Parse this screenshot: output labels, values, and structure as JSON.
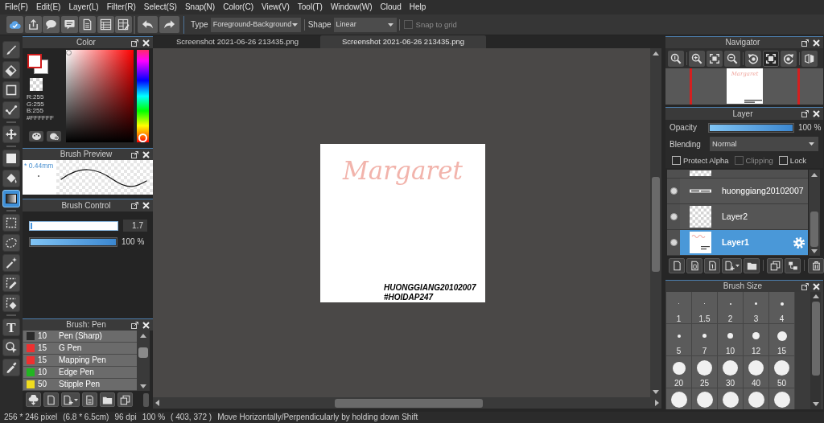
{
  "menu_bar": [
    "File(F)",
    "Edit(E)",
    "Layer(L)",
    "Filter(R)",
    "Select(S)",
    "Snap(N)",
    "Color(C)",
    "View(V)",
    "Tool(T)",
    "Window(W)",
    "Cloud",
    "Help"
  ],
  "toolbar": {
    "type": {
      "label": "Type",
      "value": "Foreground-Background"
    },
    "shape": {
      "label": "Shape",
      "value": "Linear"
    },
    "snap_to_grid": {
      "label": "Snap to grid",
      "checked": false,
      "disabled": true
    }
  },
  "tools": [
    {
      "selected": false
    },
    {
      "selected": false
    },
    {
      "selected": false
    },
    {
      "selected": false
    },
    {
      "selected": false
    },
    {
      "selected": false
    },
    {
      "selected": false
    },
    {
      "selected": true
    },
    {
      "selected": false
    },
    {
      "selected": false
    },
    {
      "selected": false
    },
    {
      "selected": false
    },
    {
      "selected": false
    },
    {
      "selected": false,
      "glyph": "T"
    },
    {
      "selected": false
    },
    {
      "selected": false
    }
  ],
  "color_panel": {
    "title": "Color",
    "readout": [
      "R:255",
      "G:255",
      "B:255",
      "#FFFFFF"
    ],
    "hue": {
      "level": 0.05
    }
  },
  "brush_preview": {
    "title": "Brush Preview",
    "size": "* 0.44mm"
  },
  "brush_control": {
    "title": "Brush Control",
    "size": {
      "level": 0.02,
      "value": "1.7"
    },
    "opacity": {
      "level": 1,
      "reading": "100 %"
    }
  },
  "brush_list": {
    "title": "Brush: Pen",
    "brushes": [
      {
        "size": "10",
        "name": "Pen (Sharp)",
        "color": "#2b2b2b",
        "selected": false
      },
      {
        "size": "15",
        "name": "G Pen",
        "color": "#ee3030",
        "selected": false
      },
      {
        "size": "15",
        "name": "Mapping Pen",
        "color": "#ee3030",
        "selected": false
      },
      {
        "size": "10",
        "name": "Edge Pen",
        "color": "#22b522",
        "selected": false
      },
      {
        "size": "50",
        "name": "Stipple Pen",
        "color": "#f0dc1e",
        "selected": false
      }
    ]
  },
  "document_tabs": [
    {
      "label": "Screenshot 2021-06-26 213435.png",
      "selected": false
    },
    {
      "label": "Screenshot 2021-06-26 213435.png",
      "selected": true
    }
  ],
  "canvas": {
    "title": "Margaret",
    "caption": [
      "HUONGGIANG20102007",
      "#HOIDAP247"
    ]
  },
  "navigator": {
    "title": "Navigator",
    "buttons": [
      {
        "selected": false
      },
      {
        "selected": false
      },
      {
        "selected": false
      },
      {
        "selected": false
      },
      {
        "selected": false
      },
      {
        "selected": true
      },
      {
        "selected": false
      },
      {
        "selected": false
      }
    ],
    "preview_text": "Margaret"
  },
  "layer_panel": {
    "title": "Layer",
    "opacity": {
      "label": "Opacity",
      "level": 1,
      "reading": "100 %"
    },
    "blending": {
      "label": "Blending",
      "value": "Normal"
    },
    "options": [
      {
        "label": "Protect Alpha",
        "checked": false,
        "disabled": false
      },
      {
        "label": "Clipping",
        "checked": false,
        "disabled": true
      },
      {
        "label": "Lock",
        "checked": false,
        "disabled": false
      }
    ],
    "layers": [
      {
        "name": "huonggiang20102007",
        "visible": true,
        "selected": false
      },
      {
        "name": "Layer2",
        "visible": true,
        "selected": false
      },
      {
        "name": "Layer1",
        "visible": true,
        "selected": true
      }
    ]
  },
  "brush_size": {
    "title": "Brush Size",
    "sizes": [
      {
        "label": "1",
        "selected": false
      },
      {
        "label": "1.5",
        "selected": false
      },
      {
        "label": "2",
        "selected": false
      },
      {
        "label": "3",
        "selected": false
      },
      {
        "label": "4",
        "selected": false
      },
      {
        "label": "5",
        "selected": false
      },
      {
        "label": "7",
        "selected": false
      },
      {
        "label": "10",
        "selected": false
      },
      {
        "label": "12",
        "selected": false
      },
      {
        "label": "15",
        "selected": false
      },
      {
        "label": "20",
        "selected": false
      },
      {
        "label": "25",
        "selected": false
      },
      {
        "label": "30",
        "selected": false
      },
      {
        "label": "40",
        "selected": false
      },
      {
        "label": "50",
        "selected": false
      }
    ]
  },
  "status_bar": {
    "size": "256 * 246 pixel",
    "print_size": "(6.8 * 6.5cm)",
    "dpi": "96 dpi",
    "zoom": "100 %",
    "cursor": "( 403, 372 )",
    "hint": "Move Horizontally/Perpendicularly by holding down Shift"
  }
}
